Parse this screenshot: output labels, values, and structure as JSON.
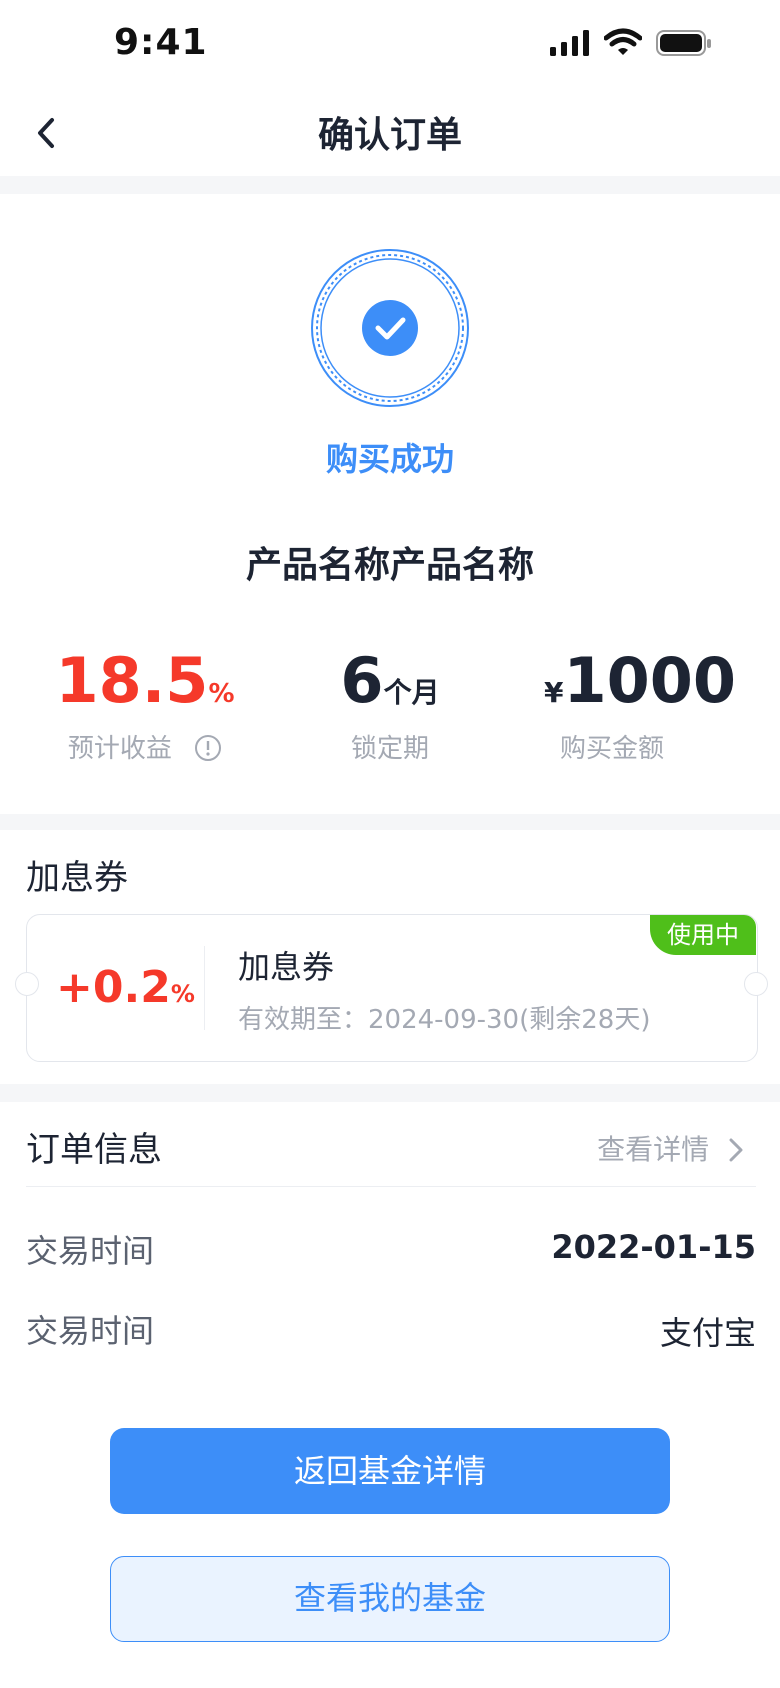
{
  "status_bar": {
    "time": "9:41"
  },
  "nav": {
    "title": "确认订单"
  },
  "result": {
    "text": "购买成功",
    "product_name": "产品名称产品名称"
  },
  "stats": {
    "rate_value": "18.5",
    "rate_unit": "%",
    "rate_label": "预计收益",
    "lock_value": "6",
    "lock_unit": "个月",
    "lock_label": "锁定期",
    "amount_currency": "¥",
    "amount_value": "1000",
    "amount_label": "购买金额"
  },
  "coupon_section": {
    "title": "加息券",
    "coupon_value": "+0.2",
    "coupon_unit": "%",
    "coupon_name": "加息券",
    "coupon_validity": "有效期至：2024-09-30(剩余28天)",
    "badge": "使用中"
  },
  "order": {
    "title": "订单信息",
    "detail_link": "查看详情",
    "rows": [
      {
        "label": "交易时间",
        "value": "2022-01-15"
      },
      {
        "label": "交易时间",
        "value": "支付宝"
      }
    ]
  },
  "buttons": {
    "back_to_fund": "返回基金详情",
    "view_my_fund": "查看我的基金"
  },
  "colors": {
    "accent": "#3d8ef8",
    "red": "#f5392a",
    "green": "#4fbf1a"
  }
}
